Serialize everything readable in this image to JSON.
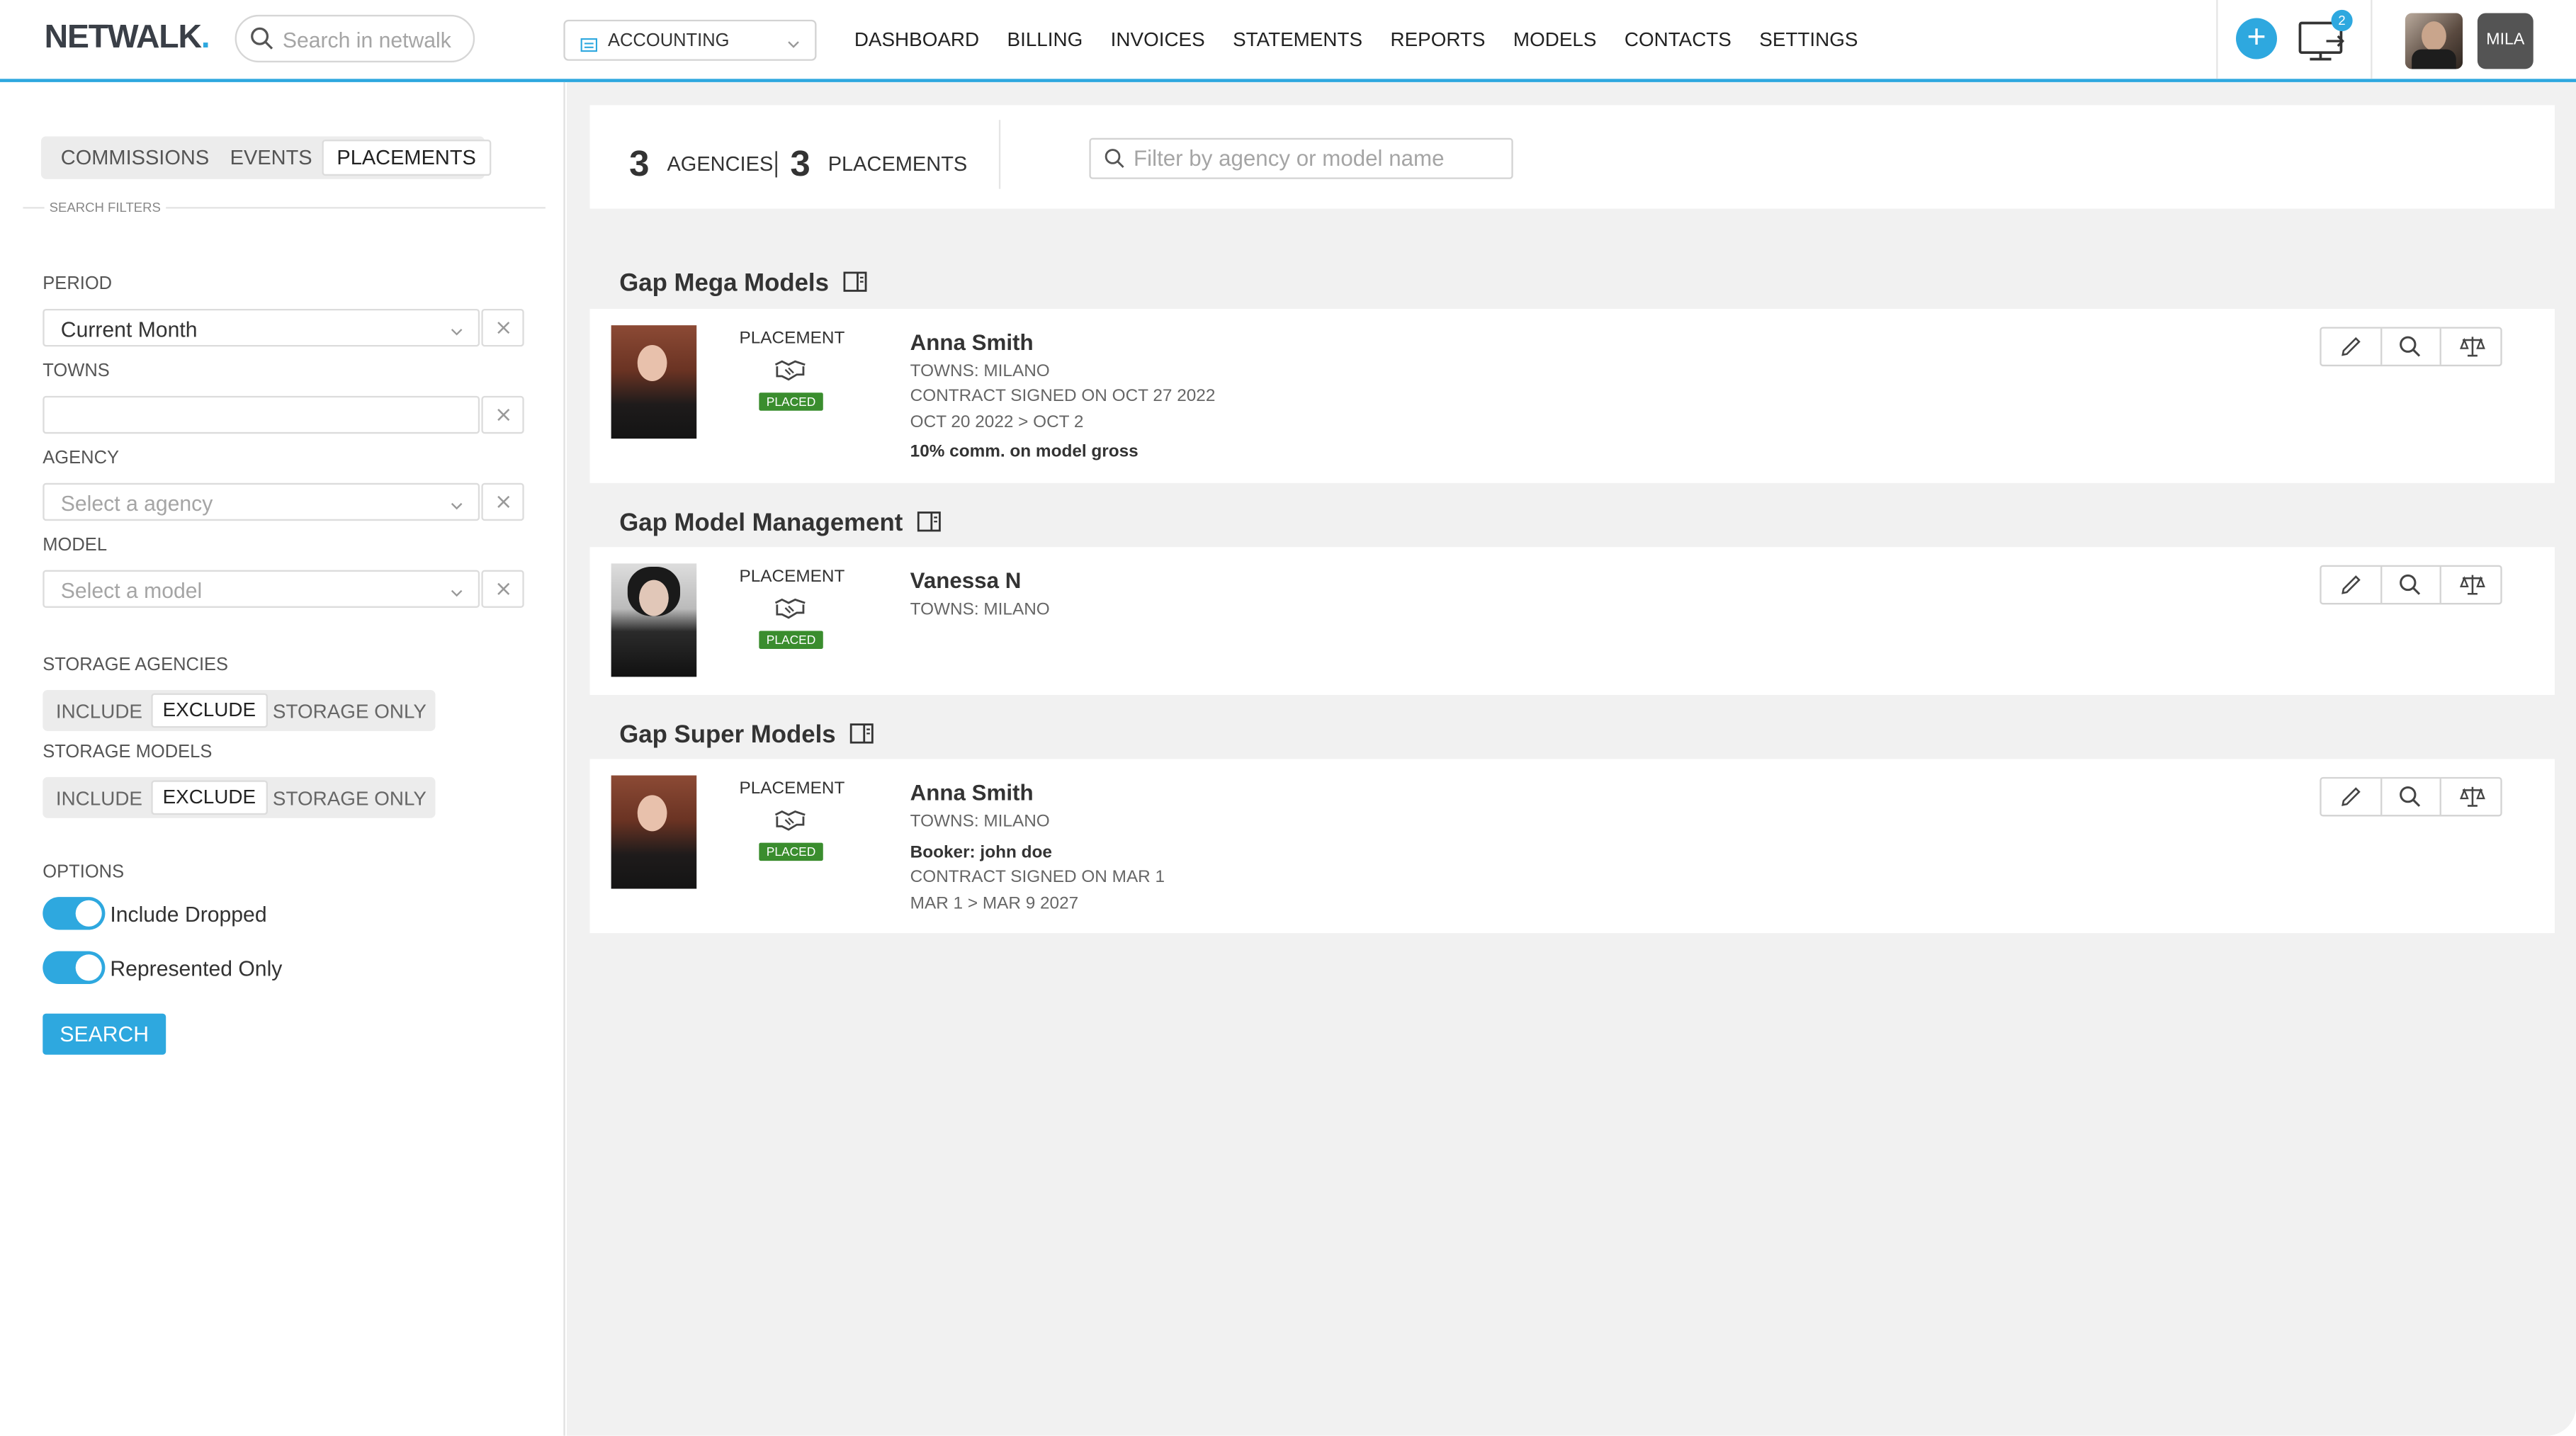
{
  "topbar": {
    "logo": "NETWALK",
    "logo_dot": ".",
    "search_placeholder": "Search in netwalk",
    "context_label": "ACCOUNTING",
    "nav": [
      "DASHBOARD",
      "BILLING",
      "INVOICES",
      "STATEMENTS",
      "REPORTS",
      "MODELS",
      "CONTACTS",
      "SETTINGS"
    ],
    "notif_count": "2",
    "user_initials": "MILA",
    "accent": "#2ea8df"
  },
  "sidebar": {
    "tabs": [
      "COMMISSIONS",
      "EVENTS",
      "PLACEMENTS"
    ],
    "active_tab": "PLACEMENTS",
    "search_filters_label": "SEARCH FILTERS",
    "period_label": "PERIOD",
    "period_value": "Current Month",
    "towns_label": "TOWNS",
    "agency_label": "AGENCY",
    "agency_placeholder": "Select a agency",
    "model_label": "MODEL",
    "model_placeholder": "Select a model",
    "storage_agencies_label": "STORAGE AGENCIES",
    "storage_models_label": "STORAGE MODELS",
    "storage_options": [
      "INCLUDE",
      "EXCLUDE",
      "STORAGE ONLY"
    ],
    "storage_agencies_selected": "EXCLUDE",
    "storage_models_selected": "EXCLUDE",
    "options_label": "OPTIONS",
    "include_dropped_label": "Include Dropped",
    "include_dropped_on": true,
    "represented_only_label": "Represented Only",
    "represented_only_on": true,
    "search_button": "SEARCH"
  },
  "summary": {
    "agencies_count": "3",
    "agencies_label": "AGENCIES",
    "placements_count": "3",
    "placements_label": "PLACEMENTS",
    "filter_placeholder": "Filter by agency or model name"
  },
  "groups": [
    {
      "agency": "Gap Mega Models",
      "placement_label": "PLACEMENT",
      "status": "PLACED",
      "model": "Anna Smith",
      "towns": "TOWNS: MILANO",
      "contract": "CONTRACT SIGNED ON OCT 27 2022",
      "dates": "OCT 20 2022 > OCT 2",
      "commission": "10% comm. on model gross"
    },
    {
      "agency": "Gap Model Management",
      "placement_label": "PLACEMENT",
      "status": "PLACED",
      "model": "Vanessa N",
      "towns": "TOWNS: MILANO"
    },
    {
      "agency": "Gap Super Models",
      "placement_label": "PLACEMENT",
      "status": "PLACED",
      "model": "Anna Smith",
      "towns": "TOWNS: MILANO",
      "booker": "Booker: john doe",
      "contract": "CONTRACT SIGNED ON MAR 1",
      "dates": "MAR 1 > MAR 9 2027"
    }
  ]
}
